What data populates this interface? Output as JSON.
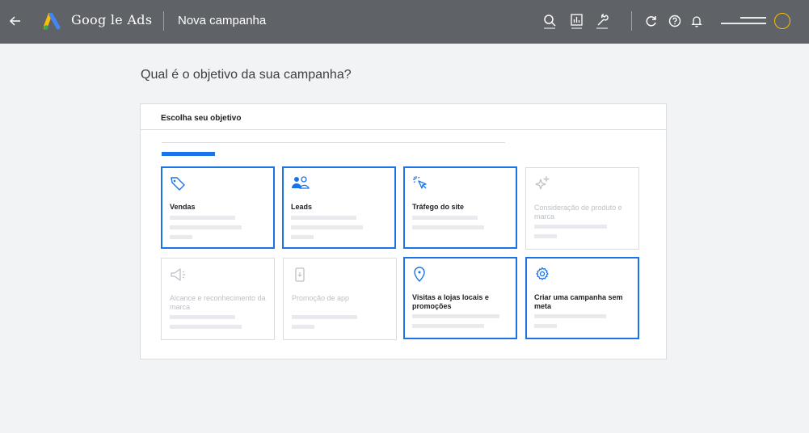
{
  "header": {
    "brand": "Goog le Ads",
    "page_name": "Nova campanha",
    "icons": [
      "back-arrow-icon",
      "google-ads-logo",
      "search-icon",
      "reports-icon",
      "tools-wrench-icon",
      "refresh-icon",
      "help-icon",
      "notifications-bell-icon",
      "account-avatar"
    ]
  },
  "main": {
    "question": "Qual é o objetivo da sua campanha?",
    "panel_title": "Escolha seu objetivo",
    "cards": [
      {
        "label": "Vendas",
        "icon": "tag-icon",
        "state": "enabled"
      },
      {
        "label": "Leads",
        "icon": "people-icon",
        "state": "enabled"
      },
      {
        "label": "Tráfego do site",
        "icon": "cursor-click-icon",
        "state": "enabled"
      },
      {
        "label": "Consideração de produto e marca",
        "icon": "sparkle-icon",
        "state": "disabled"
      },
      {
        "label": "Alcance e reconhecimento da marca",
        "icon": "megaphone-icon",
        "state": "disabled"
      },
      {
        "label": "Promoção de app",
        "icon": "phone-download-icon",
        "state": "disabled"
      },
      {
        "label": "Visitas a lojas locais e promoções",
        "icon": "location-pin-icon",
        "state": "enabled"
      },
      {
        "label": "Criar uma campanha sem meta",
        "icon": "settings-gear-icon",
        "state": "enabled"
      }
    ]
  },
  "colors": {
    "topbar": "#5f6368",
    "accent": "#1a73e8",
    "background": "#f1f3f4",
    "avatar_ring": "#fbbc04"
  }
}
